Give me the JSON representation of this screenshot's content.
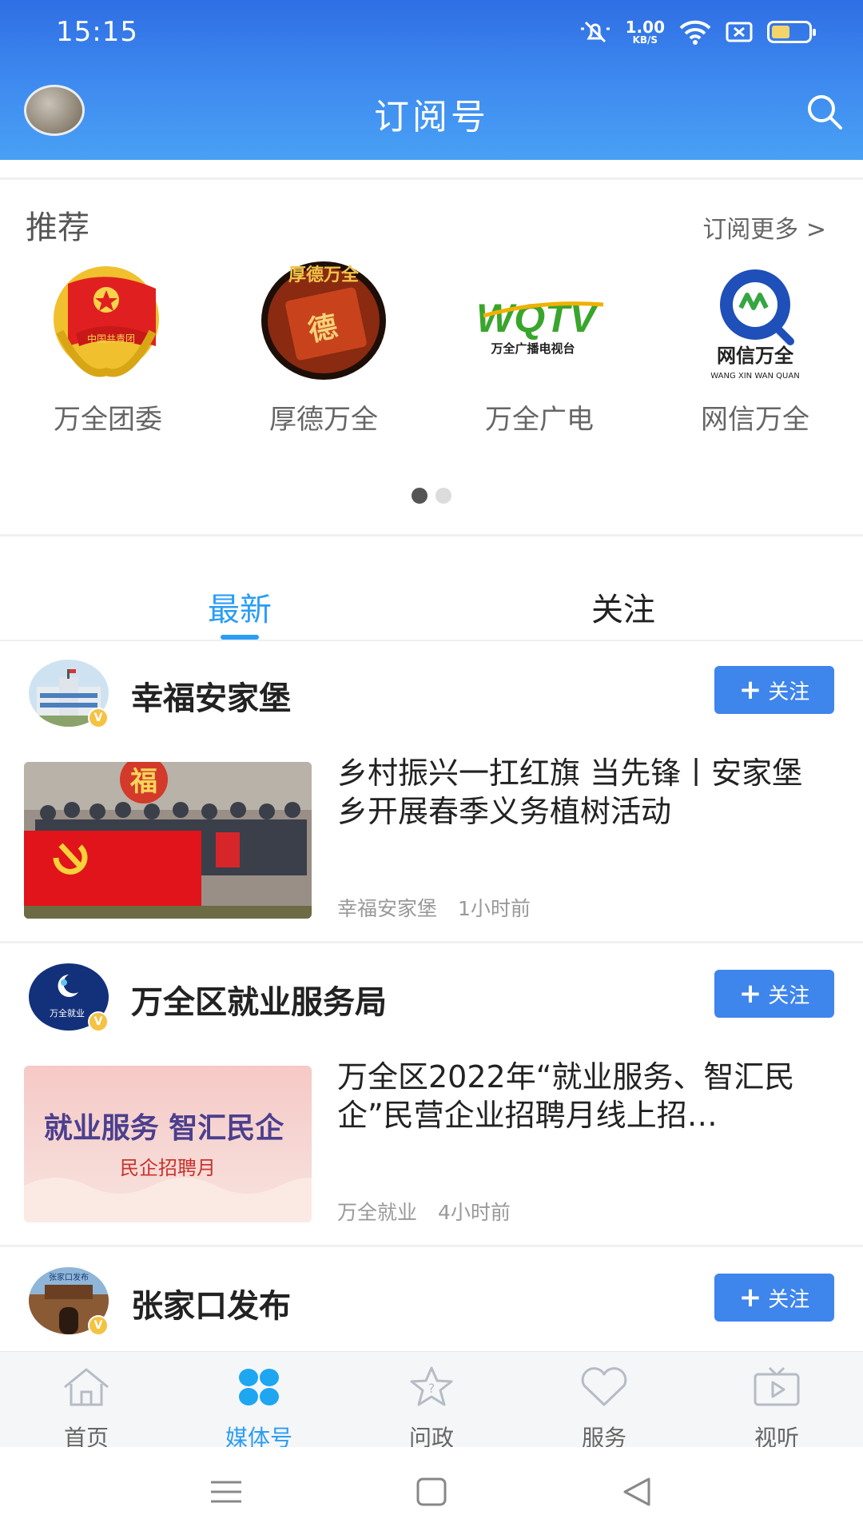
{
  "status_bar": {
    "time": "15:15",
    "net_speed": "1.00",
    "net_unit": "KB/S"
  },
  "header": {
    "title": "订阅号"
  },
  "recommend": {
    "title": "推荐",
    "more_label": "订阅更多 >",
    "items": [
      {
        "name": "万全团委",
        "logo_text": "中国共青团"
      },
      {
        "name": "厚德万全",
        "logo_text": "厚德万全"
      },
      {
        "name": "万全广电",
        "logo_text": "WQTV",
        "logo_subtext": "万全广播电视台"
      },
      {
        "name": "网信万全",
        "logo_text": "网信万全",
        "logo_subtext": "WANG XIN WAN QUAN"
      }
    ]
  },
  "tabs": [
    {
      "label": "最新"
    },
    {
      "label": "关注"
    }
  ],
  "feed": [
    {
      "account": "幸福安家堡",
      "follow_label": "关注",
      "headline": "乡村振兴一扛红旗 当先锋丨安家堡乡开展春季义务植树活动",
      "source": "幸福安家堡",
      "time": "1小时前",
      "image_text": "福"
    },
    {
      "account": "万全区就业服务局",
      "avatar_text": "万全就业",
      "follow_label": "关注",
      "headline": "万全区2022年“就业服务、智汇民企”民营企业招聘月线上招…",
      "source": "万全就业",
      "time": "4小时前",
      "image_text": "就业服务 智汇民企",
      "image_subtext": "民企招聘月"
    },
    {
      "account": "张家口发布",
      "avatar_text": "张家口发布",
      "follow_label": "关注"
    }
  ],
  "bottom_nav": [
    {
      "label": "首页",
      "icon": "home-icon"
    },
    {
      "label": "媒体号",
      "icon": "media-icon",
      "active": true
    },
    {
      "label": "问政",
      "icon": "star-question-icon"
    },
    {
      "label": "服务",
      "icon": "heart-icon"
    },
    {
      "label": "视听",
      "icon": "tv-play-icon"
    }
  ],
  "colors": {
    "header_blue": "#3f8cf0",
    "accent": "#2a9df4",
    "follow_button": "#3e85ec"
  }
}
